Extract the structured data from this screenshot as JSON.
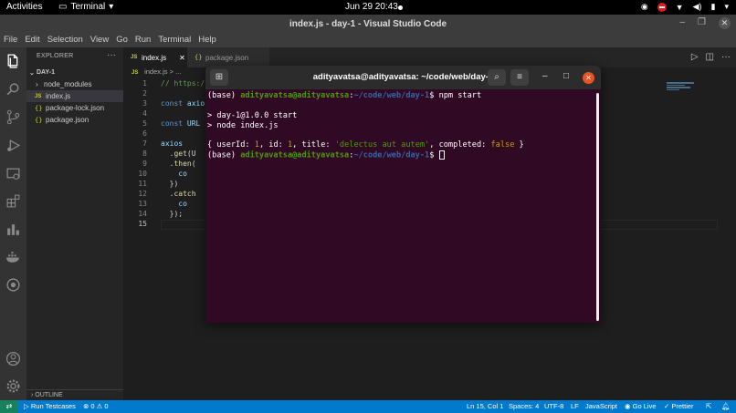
{
  "topbar": {
    "activities": "Activities",
    "app": "Terminal",
    "clock": "Jun 29  20:43"
  },
  "window": {
    "title": "index.js - day-1 - Visual Studio Code"
  },
  "menu": [
    "File",
    "Edit",
    "Selection",
    "View",
    "Go",
    "Run",
    "Terminal",
    "Help"
  ],
  "sidebar": {
    "header": "EXPLORER",
    "root": "DAY-1",
    "items": [
      {
        "label": "node_modules",
        "kind": "folder"
      },
      {
        "label": "index.js",
        "kind": "js"
      },
      {
        "label": "package-lock.json",
        "kind": "json"
      },
      {
        "label": "package.json",
        "kind": "json"
      }
    ],
    "outline": "OUTLINE"
  },
  "tabs": [
    {
      "label": "index.js",
      "active": true
    },
    {
      "label": "package.json",
      "active": false
    }
  ],
  "breadcrumb": "index.js > ...",
  "editor": {
    "line_numbers": [
      "1",
      "2",
      "3",
      "4",
      "5",
      "6",
      "7",
      "8",
      "9",
      "10",
      "11",
      "12",
      "13",
      "14",
      "15"
    ],
    "lines": {
      "l1": "// https:/",
      "l3_kw": "const",
      "l3_rest": " axio",
      "l5_kw": "const",
      "l5_rest": " URL",
      "l7": "axios",
      "l8_a": "  .",
      "l8_fn": "get",
      "l8_b": "(U",
      "l9_a": "  .",
      "l9_fn": "then",
      "l9_b": "(",
      "l10": "    co",
      "l11": "  })",
      "l12_a": "  .",
      "l12_fn": "catch",
      "l13": "    co",
      "l14": "  });"
    }
  },
  "terminal": {
    "title": "adityavatsa@adityavatsa: ~/code/web/day-1",
    "prompt_base": "(base) ",
    "prompt_user": "adityavatsa@adityavatsa",
    "prompt_colon": ":",
    "prompt_path": "~/code/web/day-1",
    "prompt_dollar": "$ ",
    "command": "npm start",
    "out1": "> day-1@1.0.0 start",
    "out2": "> node index.js",
    "obj_open": "{ userId: ",
    "obj_uid": "1",
    "obj_id_label": ", id: ",
    "obj_id": "1",
    "obj_title_label": ", title: ",
    "obj_title": "'delectus aut autem'",
    "obj_completed_label": ", completed: ",
    "obj_completed": "false",
    "obj_close": " }"
  },
  "status": {
    "run": "Run Testcases",
    "problems": "⊗ 0 ⚠ 0",
    "position": "Ln 15, Col 1",
    "spaces": "Spaces: 4",
    "encoding": "UTF-8",
    "eol": "LF",
    "language": "JavaScript",
    "golive": "Go Live",
    "prettier": "✓ Prettier"
  }
}
